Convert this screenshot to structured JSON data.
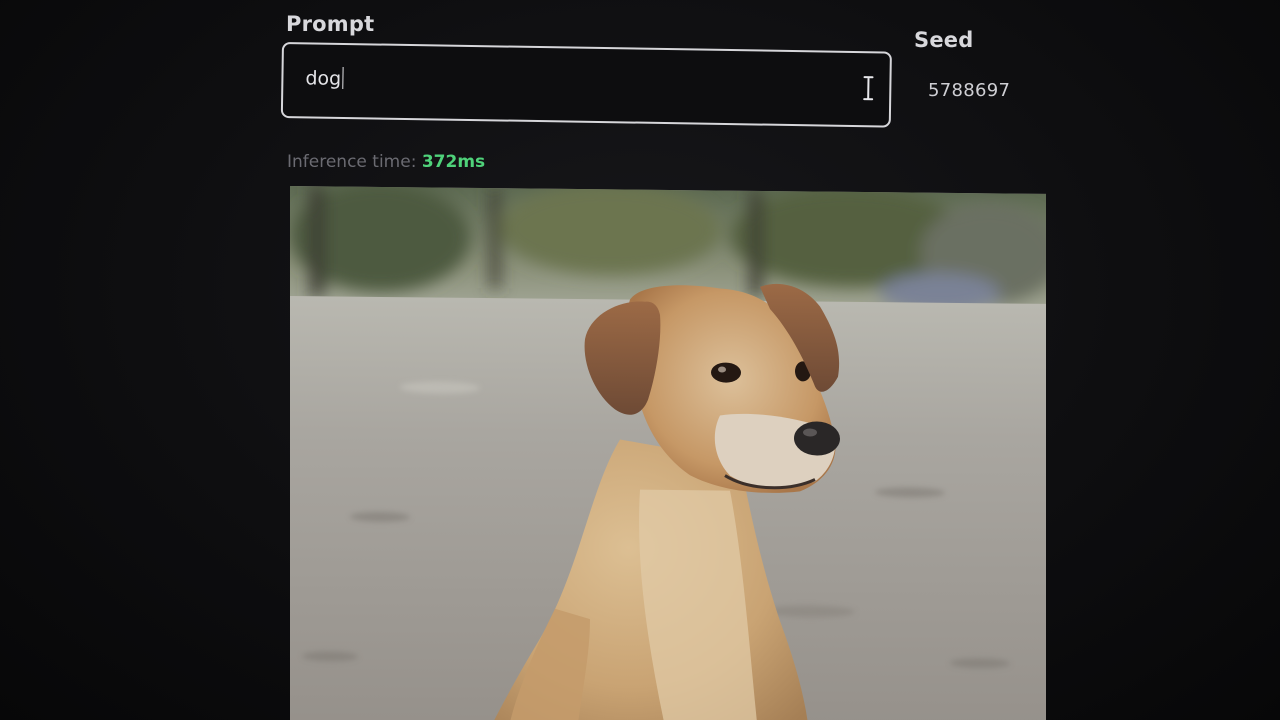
{
  "prompt": {
    "label": "Prompt",
    "value": "dog"
  },
  "seed": {
    "label": "Seed",
    "value": "5788697"
  },
  "inference": {
    "label": "Inference time:",
    "time": "372ms"
  },
  "image": {
    "subject": "dog",
    "icon": "generated-image"
  },
  "colors": {
    "background": "#0e0e10",
    "accent_time": "#4fd27a",
    "text": "#d8d8dc",
    "muted": "#6b6b72"
  }
}
